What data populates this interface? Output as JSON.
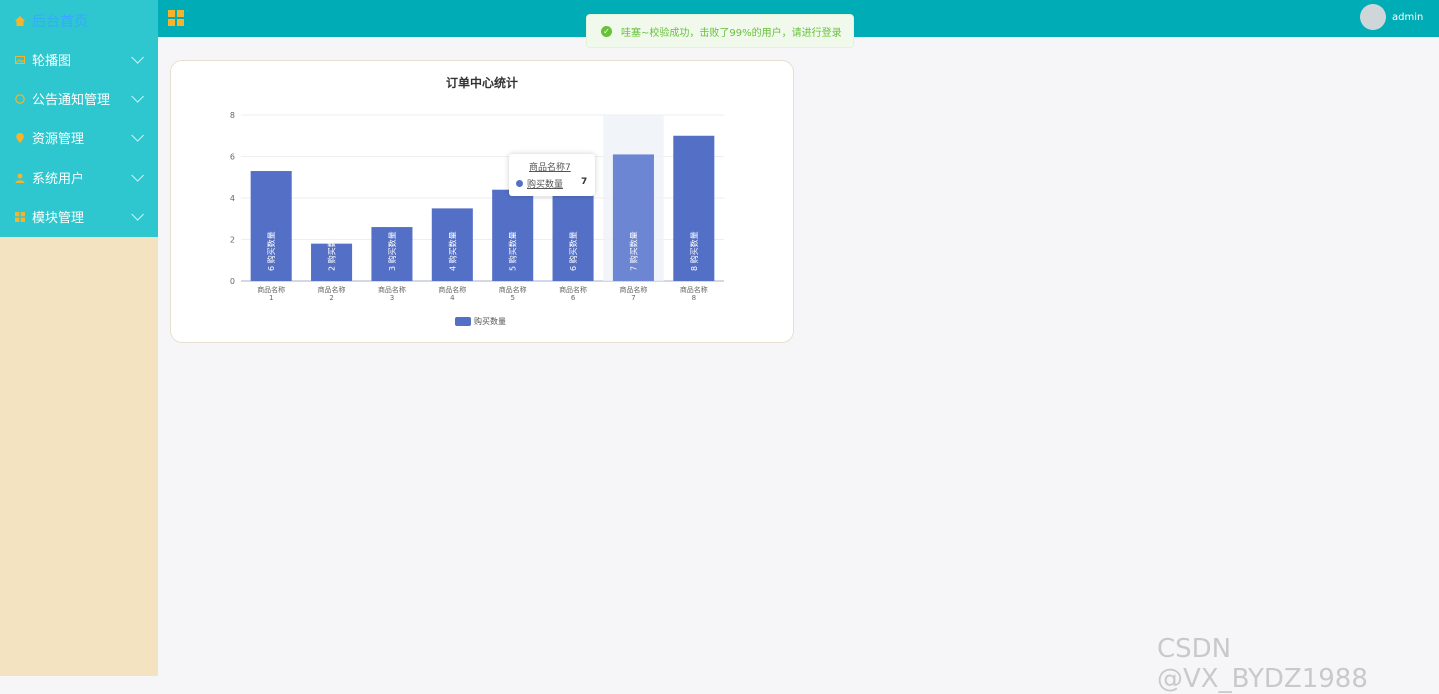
{
  "sidebar": {
    "items": [
      {
        "label": "后台首页",
        "icon": "home-icon",
        "active": true
      },
      {
        "label": "轮播图",
        "icon": "image-icon"
      },
      {
        "label": "公告通知管理",
        "icon": "circle-icon"
      },
      {
        "label": "资源管理",
        "icon": "location-pin-icon"
      },
      {
        "label": "系统用户",
        "icon": "user-icon"
      },
      {
        "label": "模块管理",
        "icon": "grid-icon"
      }
    ]
  },
  "header": {
    "title": "...",
    "username": "admin"
  },
  "toast": {
    "message": "哇塞~校验成功，击败了99%的用户，请进行登录"
  },
  "tooltip": {
    "title": "商品名称7",
    "series": "购买数量",
    "value": "7"
  },
  "watermark": "CSDN @VX_BYDZ1988",
  "colors": {
    "bar": "#5470c6",
    "bar_highlight": "#6c86d3",
    "sidebar_menu": "#2ec7cf",
    "topbar": "#00acb5"
  },
  "chart_data": {
    "type": "bar",
    "title": "订单中心统计",
    "categories": [
      "商品名称1",
      "商品名称2",
      "商品名称3",
      "商品名称4",
      "商品名称5",
      "商品名称6",
      "商品名称7",
      "商品名称8"
    ],
    "series": [
      {
        "name": "购买数量",
        "values": [
          5.3,
          1.8,
          2.6,
          3.5,
          4.4,
          5.2,
          6.1,
          7.0
        ]
      }
    ],
    "bar_labels": [
      "6 购买数量",
      "2 购买数量",
      "3 购买数量",
      "4 购买数量",
      "5 购买数量",
      "6 购买数量",
      "7 购买数量",
      "8 购买数量"
    ],
    "ylim": [
      0,
      8
    ],
    "yticks": [
      "0",
      "2",
      "4",
      "6",
      "8"
    ],
    "grid": true,
    "legend_position": "bottom",
    "highlighted_category": "商品名称7"
  }
}
